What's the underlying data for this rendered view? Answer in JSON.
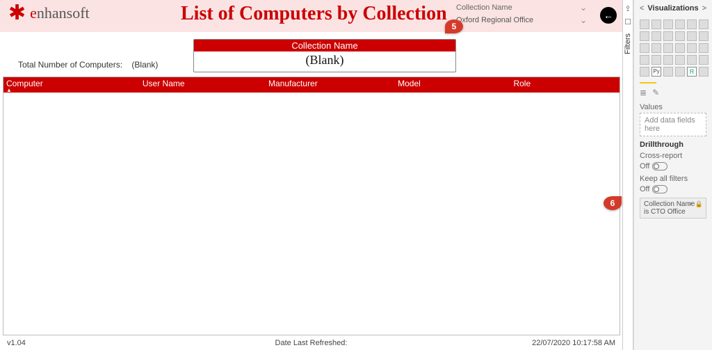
{
  "header": {
    "logo_text": "nhansoft",
    "title": "List of Computers by Collection",
    "slicer_label": "Collection Name",
    "slicer_value": "Oxford Regional Office"
  },
  "card": {
    "title": "Collection Name",
    "value": "(Blank)"
  },
  "summary": {
    "total_label": "Total Number of Computers:",
    "total_value": "(Blank)"
  },
  "table": {
    "cols": [
      "Computer",
      "User Name",
      "Manufacturer",
      "Model",
      "Role"
    ]
  },
  "footer": {
    "version": "v1.04",
    "refreshed_label": "Date Last Refreshed:",
    "refreshed_value": "22/07/2020 10:17:58 AM"
  },
  "callouts": {
    "a": "5",
    "b": "6"
  },
  "rail": {
    "filters_label": "Filters"
  },
  "pane": {
    "title": "Visualizations",
    "values_label": "Values",
    "values_placeholder": "Add data fields here",
    "drill_title": "Drillthrough",
    "cross_label": "Cross-report",
    "cross_state": "Off",
    "keep_label": "Keep all filters",
    "keep_state": "Off",
    "drill_field_name": "Collection Name",
    "drill_field_value": "is CTO Office",
    "py_label": "Py",
    "r_label": "R"
  }
}
